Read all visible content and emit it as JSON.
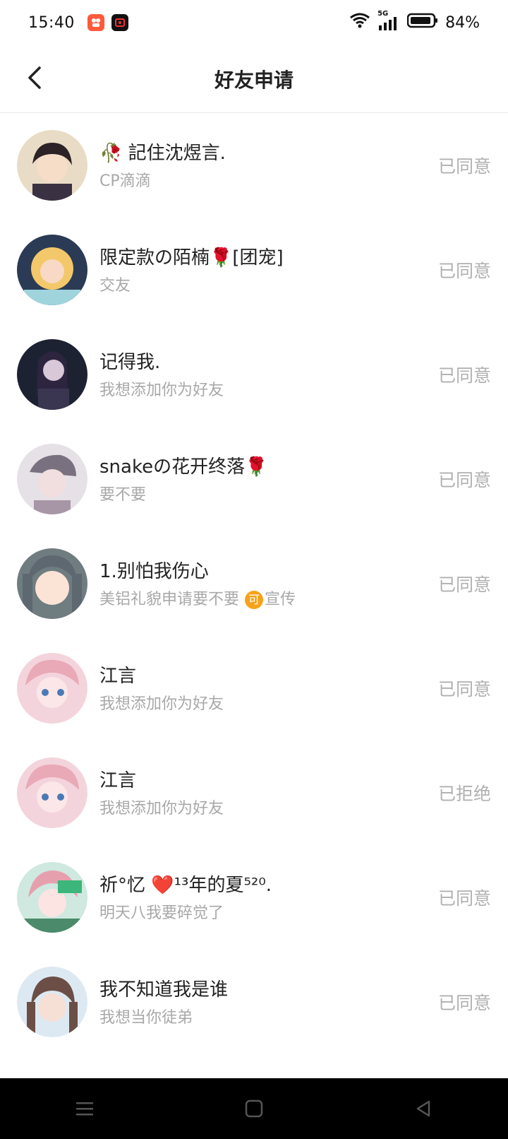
{
  "status_bar": {
    "time": "15:40",
    "battery": "84%",
    "network": "5G"
  },
  "header": {
    "title": "好友申请"
  },
  "requests": [
    {
      "name": "🥀 記住沈煜言.",
      "message": "CP滴滴",
      "status": "已同意"
    },
    {
      "name": "限定款の陌楠🌹[团宠]",
      "message": "交友",
      "status": "已同意"
    },
    {
      "name": "记得我.",
      "message": "我想添加你为好友",
      "status": "已同意"
    },
    {
      "name": "snakeの花开终落🌹",
      "message": "要不要",
      "status": "已同意"
    },
    {
      "name": "1.别怕我伤心",
      "message": "美铝礼貌申请要不要",
      "message_badge": "可",
      "message_suffix": "宣传",
      "status": "已同意"
    },
    {
      "name": "江言",
      "message": "我想添加你为好友",
      "status": "已同意"
    },
    {
      "name": "江言",
      "message": "我想添加你为好友",
      "status": "已拒绝"
    },
    {
      "name": "祈°忆 ❤️¹³年的夏⁵²⁰.",
      "message": "明天八我要碎觉了",
      "status": "已同意"
    },
    {
      "name": "我不知道我是谁",
      "message": "我想当你徒弟",
      "status": "已同意"
    }
  ],
  "colors": {
    "status_text": "#b0b0b0",
    "secondary_text": "#a8a8a8",
    "promo_badge": "#f7a21b"
  },
  "icons": {
    "back": "chevron-left-icon",
    "wifi": "wifi-icon",
    "signal": "signal-icon",
    "battery": "battery-icon",
    "menu": "menu-icon",
    "home": "home-icon",
    "back_system": "triangle-back-icon"
  }
}
